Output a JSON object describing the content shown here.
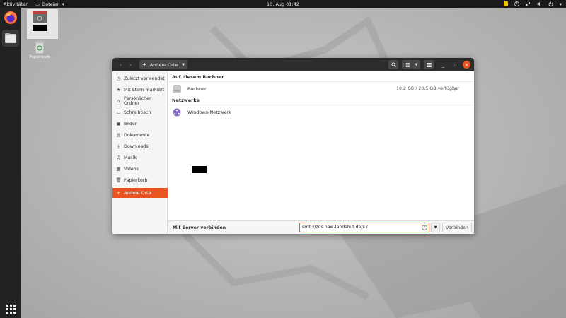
{
  "topbar": {
    "activities": "Aktivitäten",
    "app_menu": "Dateien",
    "clock": "10. Aug  01:42"
  },
  "desktop": {
    "trash_label": "Papierkorb"
  },
  "window": {
    "location": "Andere Orte",
    "sidebar": [
      {
        "label": "Zuletzt verwendet",
        "icon": "clock-icon"
      },
      {
        "label": "Mit Stern markiert",
        "icon": "star-icon"
      },
      {
        "label": "Persönlicher Ordner",
        "icon": "home-icon"
      },
      {
        "label": "Schreibtisch",
        "icon": "desktop-icon"
      },
      {
        "label": "Bilder",
        "icon": "image-icon"
      },
      {
        "label": "Dokumente",
        "icon": "document-icon"
      },
      {
        "label": "Downloads",
        "icon": "download-icon"
      },
      {
        "label": "Musik",
        "icon": "music-icon"
      },
      {
        "label": "Videos",
        "icon": "video-icon"
      },
      {
        "label": "Papierkorb",
        "icon": "trash-icon"
      },
      {
        "label": "Andere Orte",
        "icon": "plus-icon",
        "active": true
      }
    ],
    "sections": {
      "this_computer": "Auf diesem Rechner",
      "networks": "Netzwerke"
    },
    "computer_row": {
      "label": "Rechner",
      "info": "10,2 GB / 20,5 GB verfügbar",
      "path": "/"
    },
    "network_row": {
      "label": "Windows-Netzwerk"
    },
    "bottom": {
      "label": "Mit Server verbinden",
      "server_value": "smb://zds.haw-landshut.de/s           /",
      "connect_label": "Verbinden"
    }
  },
  "colors": {
    "accent": "#e95420",
    "headerbar": "#2c2c2c",
    "sidebar_bg": "#f6f5f4"
  }
}
